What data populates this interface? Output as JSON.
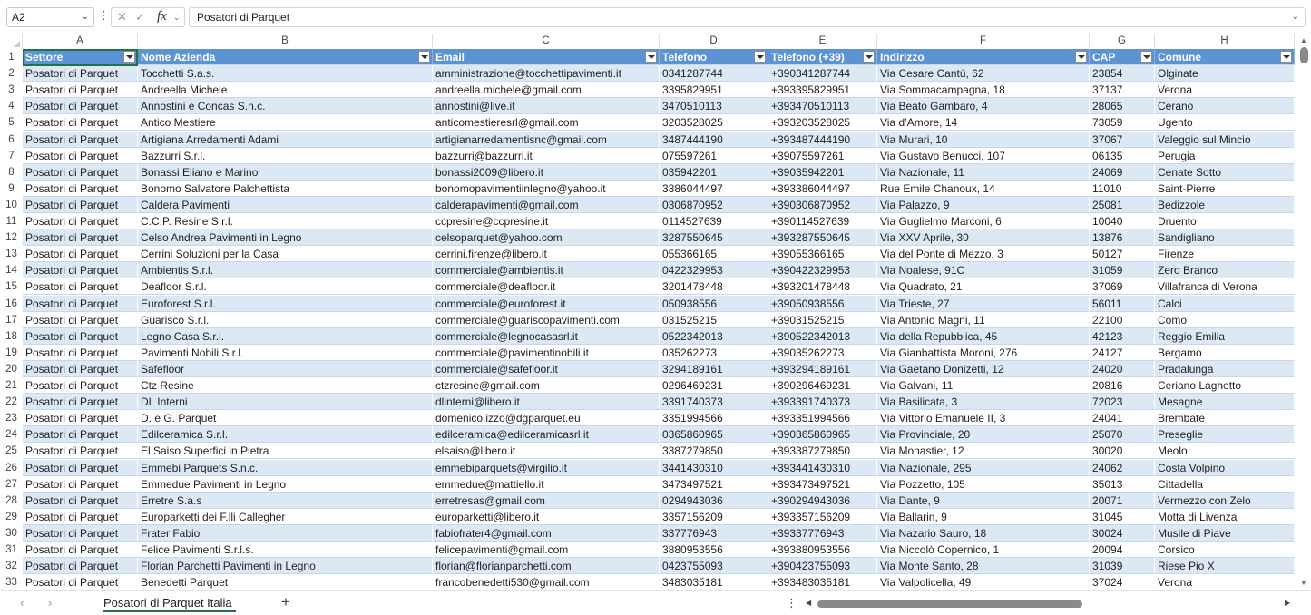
{
  "formula_bar": {
    "name_box": "A2",
    "formula": "Posatori di Parquet"
  },
  "columns": [
    "A",
    "B",
    "C",
    "D",
    "E",
    "F",
    "G",
    "H"
  ],
  "headers": [
    "Settore",
    "Nome Azienda",
    "Email",
    "Telefono",
    "Telefono (+39)",
    "Indirizzo",
    "CAP",
    "Comune"
  ],
  "rows": [
    [
      "Posatori di Parquet",
      "Tocchetti S.a.s.",
      "amministrazione@tocchettipavimenti.it",
      "0341287744",
      "+390341287744",
      "Via Cesare Cantù, 62",
      "23854",
      "Olginate"
    ],
    [
      "Posatori di Parquet",
      "Andreella Michele",
      "andreella.michele@gmail.com",
      "3395829951",
      "+393395829951",
      "Via Sommacampagna, 18",
      "37137",
      "Verona"
    ],
    [
      "Posatori di Parquet",
      "Annostini e Concas S.n.c.",
      "annostini@live.it",
      "3470510113",
      "+393470510113",
      "Via Beato Gambaro, 4",
      "28065",
      "Cerano"
    ],
    [
      "Posatori di Parquet",
      "Antico Mestiere",
      "anticomestieresrl@gmail.com",
      "3203528025",
      "+393203528025",
      "Via d’Amore, 14",
      "73059",
      "Ugento"
    ],
    [
      "Posatori di Parquet",
      "Artigiana Arredamenti Adami",
      "artigianarredamentisnc@gmail.com",
      "3487444190",
      "+393487444190",
      "Via Murari, 10",
      "37067",
      "Valeggio sul Mincio"
    ],
    [
      "Posatori di Parquet",
      "Bazzurri S.r.l.",
      "bazzurri@bazzurri.it",
      "075597261",
      "+39075597261",
      "Via Gustavo Benucci, 107",
      "06135",
      "Perugia"
    ],
    [
      "Posatori di Parquet",
      "Bonassi Eliano e Marino",
      "bonassi2009@libero.it",
      "035942201",
      "+39035942201",
      "Via Nazionale, 11",
      "24069",
      "Cenate Sotto"
    ],
    [
      "Posatori di Parquet",
      "Bonomo Salvatore Palchettista",
      "bonomopavimentiinlegno@yahoo.it",
      "3386044497",
      "+393386044497",
      "Rue Emile Chanoux, 14",
      "11010",
      "Saint-Pierre"
    ],
    [
      "Posatori di Parquet",
      "Caldera Pavimenti",
      "calderapavimenti@gmail.com",
      "0306870952",
      "+390306870952",
      "Via Palazzo, 9",
      "25081",
      "Bedizzole"
    ],
    [
      "Posatori di Parquet",
      "C.C.P. Resine S.r.l.",
      "ccpresine@ccpresine.it",
      "0114527639",
      "+390114527639",
      "Via Guglielmo Marconi, 6",
      "10040",
      "Druento"
    ],
    [
      "Posatori di Parquet",
      "Celso Andrea Pavimenti in Legno",
      "celsoparquet@yahoo.com",
      "3287550645",
      "+393287550645",
      "Via XXV Aprile, 30",
      "13876",
      "Sandigliano"
    ],
    [
      "Posatori di Parquet",
      "Cerrini Soluzioni per la Casa",
      "cerrini.firenze@libero.it",
      "055366165",
      "+39055366165",
      "Via del Ponte di Mezzo, 3",
      "50127",
      "Firenze"
    ],
    [
      "Posatori di Parquet",
      "Ambientis S.r.l.",
      "commerciale@ambientis.it",
      "0422329953",
      "+390422329953",
      "Via Noalese, 91C",
      "31059",
      "Zero Branco"
    ],
    [
      "Posatori di Parquet",
      "Deafloor S.r.l.",
      "commerciale@deafloor.it",
      "3201478448",
      "+393201478448",
      "Via Quadrato, 21",
      "37069",
      "Villafranca di Verona"
    ],
    [
      "Posatori di Parquet",
      "Euroforest S.r.l.",
      "commerciale@euroforest.it",
      "050938556",
      "+39050938556",
      "Via Trieste, 27",
      "56011",
      "Calci"
    ],
    [
      "Posatori di Parquet",
      "Guarisco S.r.l.",
      "commerciale@guariscopavimenti.com",
      "031525215",
      "+39031525215",
      "Via Antonio Magni, 11",
      "22100",
      "Como"
    ],
    [
      "Posatori di Parquet",
      "Legno Casa S.r.l.",
      "commerciale@legnocasasrl.it",
      "0522342013",
      "+390522342013",
      "Via della Repubblica, 45",
      "42123",
      "Reggio Emilia"
    ],
    [
      "Posatori di Parquet",
      "Pavimenti Nobili S.r.l.",
      "commerciale@pavimentinobili.it",
      "035262273",
      "+39035262273",
      "Via Gianbattista Moroni, 276",
      "24127",
      "Bergamo"
    ],
    [
      "Posatori di Parquet",
      "Safefloor",
      "commerciale@safefloor.it",
      "3294189161",
      "+393294189161",
      "Via Gaetano Donizetti, 12",
      "24020",
      "Pradalunga"
    ],
    [
      "Posatori di Parquet",
      "Ctz Resine",
      "ctzresine@gmail.com",
      "0296469231",
      "+390296469231",
      "Via Galvani, 11",
      "20816",
      "Ceriano Laghetto"
    ],
    [
      "Posatori di Parquet",
      "DL Interni",
      "dlinterni@libero.it",
      "3391740373",
      "+393391740373",
      "Via Basilicata, 3",
      "72023",
      "Mesagne"
    ],
    [
      "Posatori di Parquet",
      "D. e G. Parquet",
      "domenico.izzo@dgparquet.eu",
      "3351994566",
      "+393351994566",
      "Via Vittorio Emanuele II, 3",
      "24041",
      "Brembate"
    ],
    [
      "Posatori di Parquet",
      "Edilceramica S.r.l.",
      "edilceramica@edilceramicasrl.it",
      "0365860965",
      "+390365860965",
      "Via Provinciale, 20",
      "25070",
      "Preseglie"
    ],
    [
      "Posatori di Parquet",
      "El Saiso Superfici in Pietra",
      "elsaiso@libero.it",
      "3387279850",
      "+393387279850",
      "Via Monastier, 12",
      "30020",
      "Meolo"
    ],
    [
      "Posatori di Parquet",
      "Emmebi Parquets S.n.c.",
      "emmebiparquets@virgilio.it",
      "3441430310",
      "+393441430310",
      "Via Nazionale, 295",
      "24062",
      "Costa Volpino"
    ],
    [
      "Posatori di Parquet",
      "Emmedue Pavimenti in Legno",
      "emmedue@mattiello.it",
      "3473497521",
      "+393473497521",
      "Via Pozzetto, 105",
      "35013",
      "Cittadella"
    ],
    [
      "Posatori di Parquet",
      "Erretre S.a.s",
      "erretresas@gmail.com",
      "0294943036",
      "+390294943036",
      "Via Dante, 9",
      "20071",
      "Vermezzo con Zelo"
    ],
    [
      "Posatori di Parquet",
      "Europarketti dei F.lli Callegher",
      "europarketti@libero.it",
      "3357156209",
      "+393357156209",
      "Via Ballarin, 9",
      "31045",
      "Motta di Livenza"
    ],
    [
      "Posatori di Parquet",
      "Frater Fabio",
      "fabiofrater4@gmail.com",
      "337776943",
      "+39337776943",
      "Via Nazario Sauro, 18",
      "30024",
      "Musile di Piave"
    ],
    [
      "Posatori di Parquet",
      "Felice Pavimenti S.r.l.s.",
      "felicepavimenti@gmail.com",
      "3880953556",
      "+393880953556",
      "Via Niccolò Copernico, 1",
      "20094",
      "Corsico"
    ],
    [
      "Posatori di Parquet",
      "Florian Parchetti Pavimenti in Legno",
      "florian@florianparchetti.com",
      "0423755093",
      "+390423755093",
      "Via Monte Santo, 28",
      "31039",
      "Riese Pio X"
    ],
    [
      "Posatori di Parquet",
      "Benedetti Parquet",
      "francobenedetti530@gmail.com",
      "3483035181",
      "+393483035181",
      "Via Valpolicella, 49",
      "37024",
      "Verona"
    ]
  ],
  "sheet_tab": "Posatori di Parquet Italia",
  "icons": {
    "name_box_dropdown": "chevron-down-icon",
    "cancel": "x-icon",
    "enter": "check-icon",
    "function": "fx-icon",
    "add_sheet": "plus-icon"
  },
  "colors": {
    "header_fill": "#5b93d3",
    "band_fill": "#dde8f5",
    "accent": "#217346"
  }
}
